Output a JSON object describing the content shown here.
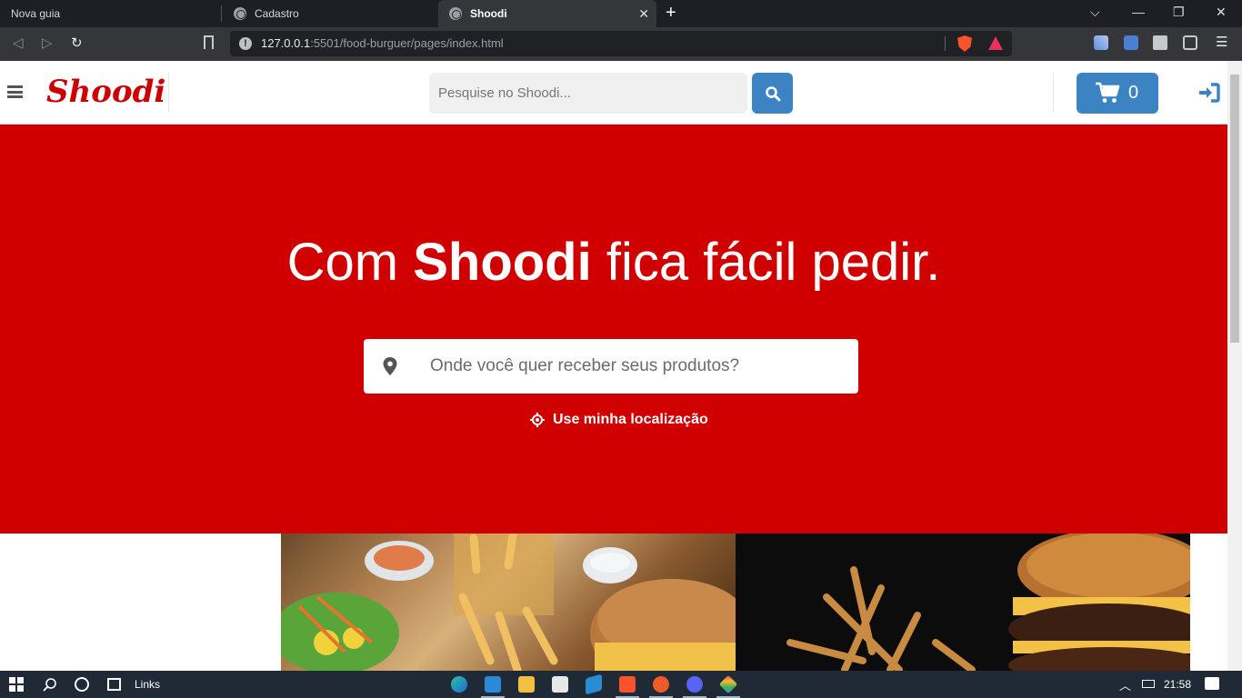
{
  "browser": {
    "tabs": [
      {
        "title": "Nova guia"
      },
      {
        "title": "Cadastro"
      },
      {
        "title": "Shoodi"
      }
    ],
    "url_host": "127.0.0.1",
    "url_rest": ":5501/food-burguer/pages/index.html"
  },
  "header": {
    "logo": "Shoodi",
    "search_placeholder": "Pesquise no Shoodi...",
    "cart_count": "0"
  },
  "hero": {
    "title_prefix": "Com ",
    "title_brand": "Shoodi",
    "title_suffix": " fica fácil pedir.",
    "location_placeholder": "Onde você quer receber seus produtos?",
    "use_location": "Use minha localização"
  },
  "taskbar": {
    "links_label": "Links",
    "clock": "21:58"
  },
  "colors": {
    "brand_red": "#d10000",
    "accent_blue": "#3c83c4"
  }
}
